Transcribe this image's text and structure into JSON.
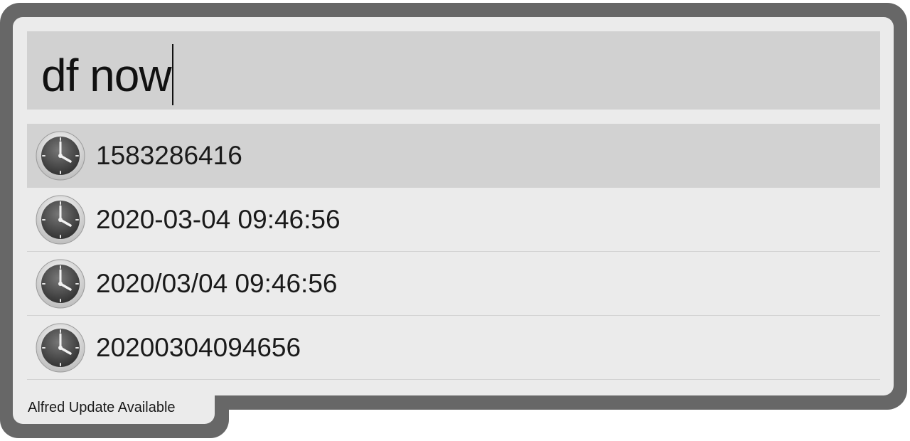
{
  "search": {
    "query": "df now"
  },
  "results": [
    {
      "title": "1583286416",
      "icon": "clock-icon",
      "selected": true
    },
    {
      "title": "2020-03-04 09:46:56",
      "icon": "clock-icon",
      "selected": false
    },
    {
      "title": "2020/03/04 09:46:56",
      "icon": "clock-icon",
      "selected": false
    },
    {
      "title": "20200304094656",
      "icon": "clock-icon",
      "selected": false
    }
  ],
  "footer": {
    "update_label": "Alfred Update Available"
  },
  "colors": {
    "frame": "#676767",
    "panel": "#ebebeb",
    "search_bg": "#d1d1d1",
    "selected_row": "#d2d2d2"
  }
}
